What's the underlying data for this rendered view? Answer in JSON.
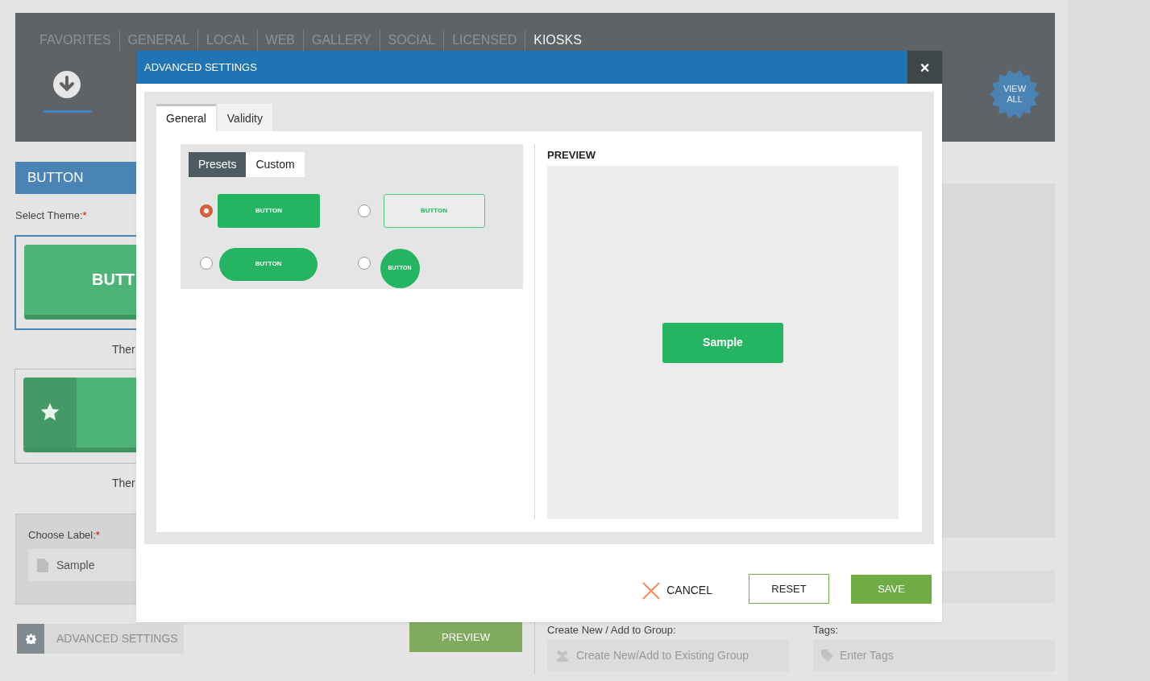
{
  "nav_tabs": [
    {
      "label": "FAVORITES",
      "selected": false
    },
    {
      "label": "GENERAL",
      "selected": false
    },
    {
      "label": "LOCAL",
      "selected": false
    },
    {
      "label": "WEB",
      "selected": false
    },
    {
      "label": "GALLERY",
      "selected": false
    },
    {
      "label": "SOCIAL",
      "selected": false
    },
    {
      "label": "LICENSED",
      "selected": false
    },
    {
      "label": "KIOSKS",
      "selected": true
    }
  ],
  "view_all": "VIEW ALL",
  "section_title": "BUTTON",
  "select_theme": {
    "label": "Select Theme:",
    "required_mark": "*"
  },
  "themes": [
    {
      "kind": "plain",
      "button_text": "BUTT",
      "caption": "Ther",
      "selected": true
    },
    {
      "kind": "icon",
      "caption": "Ther",
      "selected": false
    }
  ],
  "choose_label": {
    "label": "Choose Label:",
    "required_mark": "*",
    "value": "Sample"
  },
  "advanced_settings_button": "ADVANCED SETTINGS",
  "preview_button": "PREVIEW",
  "group_field": {
    "label": "Create New / Add to Group:",
    "placeholder": "Create New/Add to Existing Group"
  },
  "tags_field": {
    "label": "Tags:",
    "placeholder": "Enter Tags"
  },
  "modal": {
    "title": "ADVANCED SETTINGS",
    "close": "×",
    "tabs": [
      {
        "label": "General",
        "selected": true
      },
      {
        "label": "Validity",
        "selected": false
      }
    ],
    "mode_tabs": [
      {
        "label": "Presets",
        "selected": true
      },
      {
        "label": "Custom",
        "selected": false
      }
    ],
    "presets": [
      {
        "kind": "filled",
        "label": "BUTTON",
        "selected": true
      },
      {
        "kind": "outline",
        "label": "BUTTON",
        "selected": false
      },
      {
        "kind": "pill",
        "label": "BUTTON",
        "selected": false
      },
      {
        "kind": "circle",
        "label": "BUTTON",
        "selected": false
      }
    ],
    "preview": {
      "title": "PREVIEW",
      "sample": "Sample"
    },
    "cancel": "CANCEL",
    "reset": "RESET",
    "save": "SAVE"
  }
}
